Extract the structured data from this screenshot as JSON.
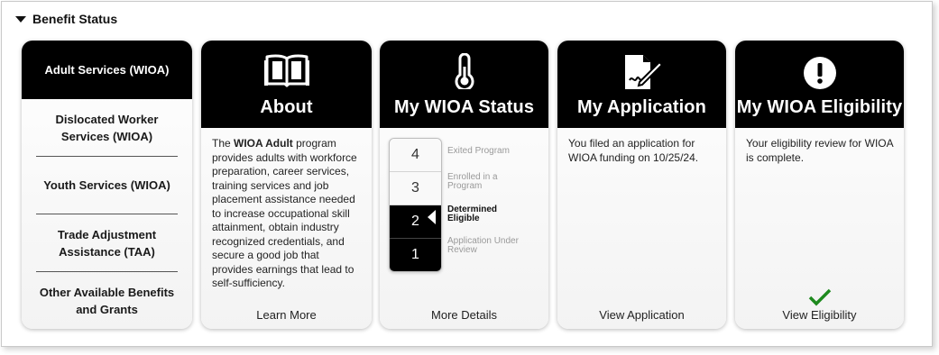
{
  "header": {
    "title": "Benefit Status"
  },
  "nav": {
    "items": [
      {
        "label": "Adult Services (WIOA)",
        "active": true
      },
      {
        "label": "Dislocated Worker Services (WIOA)",
        "active": false
      },
      {
        "label": "Youth Services (WIOA)",
        "active": false
      },
      {
        "label": "Trade Adjustment Assistance (TAA)",
        "active": false
      },
      {
        "label": "Other Available Benefits and Grants",
        "active": false
      }
    ]
  },
  "about": {
    "title": "About",
    "icon": "book-icon",
    "text_before": "The ",
    "text_bold": "WIOA Adult",
    "text_after": " program provides adults with workforce preparation, career services, training services and job placement assistance needed to increase occupational skill attainment, obtain industry recognized credentials, and secure a good job that provides earnings that lead to self-sufficiency.",
    "link": "Learn More"
  },
  "status": {
    "title": "My WIOA Status",
    "icon": "thermometer-icon",
    "steps": [
      {
        "number": "4",
        "label": "Exited Program"
      },
      {
        "number": "3",
        "label": "Enrolled in a Program"
      },
      {
        "number": "2",
        "label": "Determined Eligible"
      },
      {
        "number": "1",
        "label": "Application Under Review"
      }
    ],
    "current_step": "2",
    "link": "More Details"
  },
  "application": {
    "title": "My Application",
    "icon": "signed-document-icon",
    "text": "You filed an application for WIOA funding on 10/25/24.",
    "link": "View Application"
  },
  "eligibility": {
    "title": "My WIOA Eligibility",
    "icon": "exclamation-circle-icon",
    "text": "Your eligibility review for WIOA is complete.",
    "status_icon": "checkmark-icon",
    "status_color": "#1e8a1e",
    "link": "View Eligibility"
  }
}
